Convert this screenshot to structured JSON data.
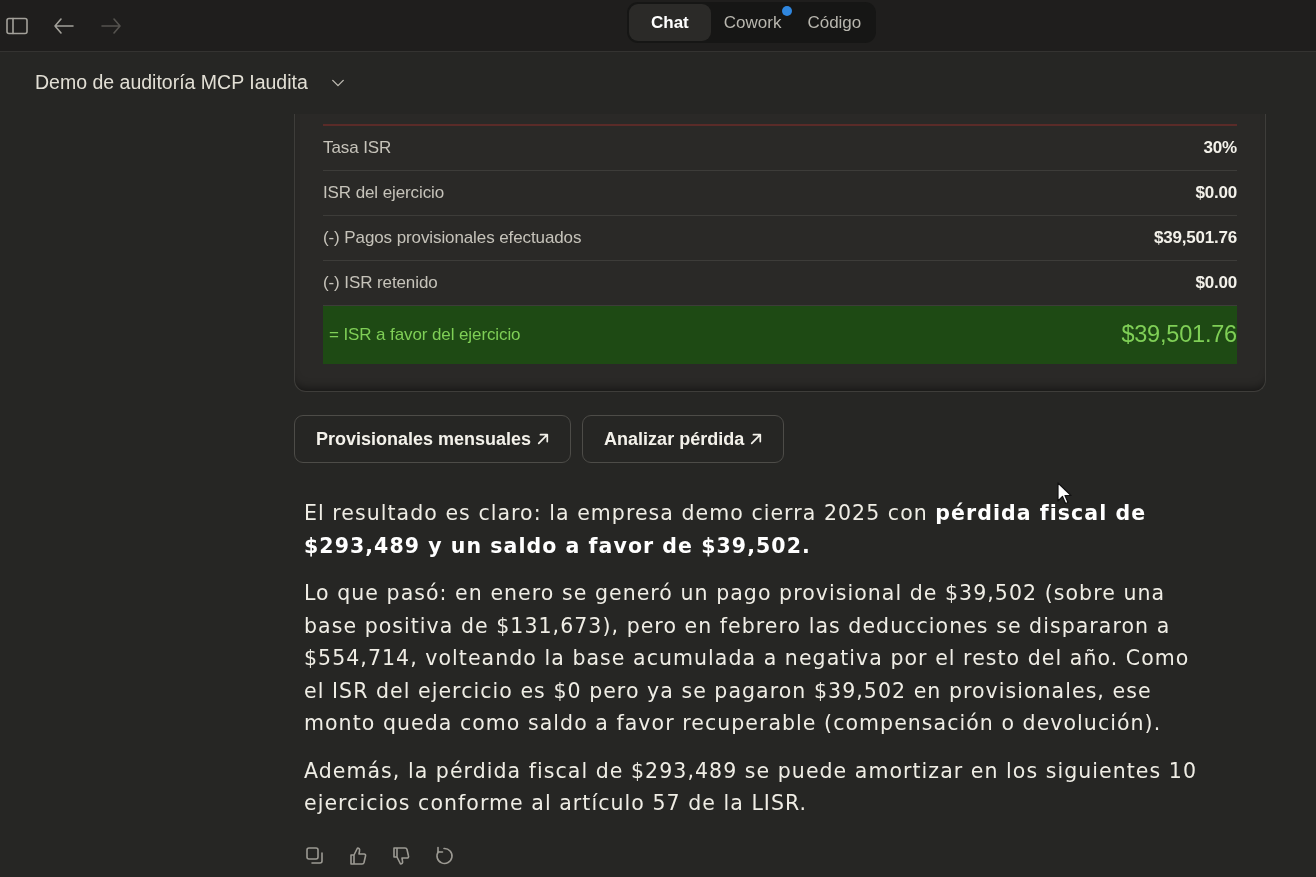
{
  "toolbar": {
    "nav_buttons": [
      {
        "kind": "back",
        "disabled": false
      },
      {
        "kind": "forward",
        "disabled": true
      }
    ],
    "tabs": [
      {
        "label": "Chat",
        "selected": true,
        "unread": false
      },
      {
        "label": "Cowork",
        "selected": false,
        "unread": true
      },
      {
        "label": "Código",
        "selected": false,
        "unread": false
      }
    ]
  },
  "conversation": {
    "title": "Demo de auditoría MCP Iaudita"
  },
  "summary_table": {
    "rows": [
      {
        "label": "Tasa ISR",
        "value": "30%",
        "kind": "line"
      },
      {
        "label": "ISR del ejercicio",
        "value": "$0.00",
        "kind": "line"
      },
      {
        "label": "(-) Pagos provisionales efectuados",
        "value": "$39,501.76",
        "kind": "line"
      },
      {
        "label": "(-) ISR retenido",
        "value": "$0.00",
        "kind": "line"
      },
      {
        "label": "= ISR a favor del ejercicio",
        "value": "$39,501.76",
        "kind": "total"
      }
    ]
  },
  "action_buttons": [
    {
      "label": "Provisionales mensuales"
    },
    {
      "label": "Analizar pérdida"
    }
  ],
  "paragraphs": [
    "El resultado es claro: la empresa demo cierra 2025 con **pérdida fiscal de $293,489 y un saldo a favor de $39,502.**",
    "Lo que pasó: en enero se generó un pago provisional de $39,502 (sobre una base positiva de $131,673), pero en febrero las deducciones se dispararon a $554,714, volteando la base acumulada a negativa por el resto del año. Como el ISR del ejercicio es $0 pero ya se pagaron $39,502 en provisionales, ese monto queda como saldo a favor recuperable (compensación o devolución).",
    "Además, la pérdida fiscal de $293,489 se puede amortizar en los siguientes 10 ejercicios conforme al artículo 57 de la LISR."
  ],
  "message_actions": [
    {
      "kind": "copy"
    },
    {
      "kind": "thumbs_up"
    },
    {
      "kind": "thumbs_down"
    },
    {
      "kind": "retry"
    }
  ]
}
